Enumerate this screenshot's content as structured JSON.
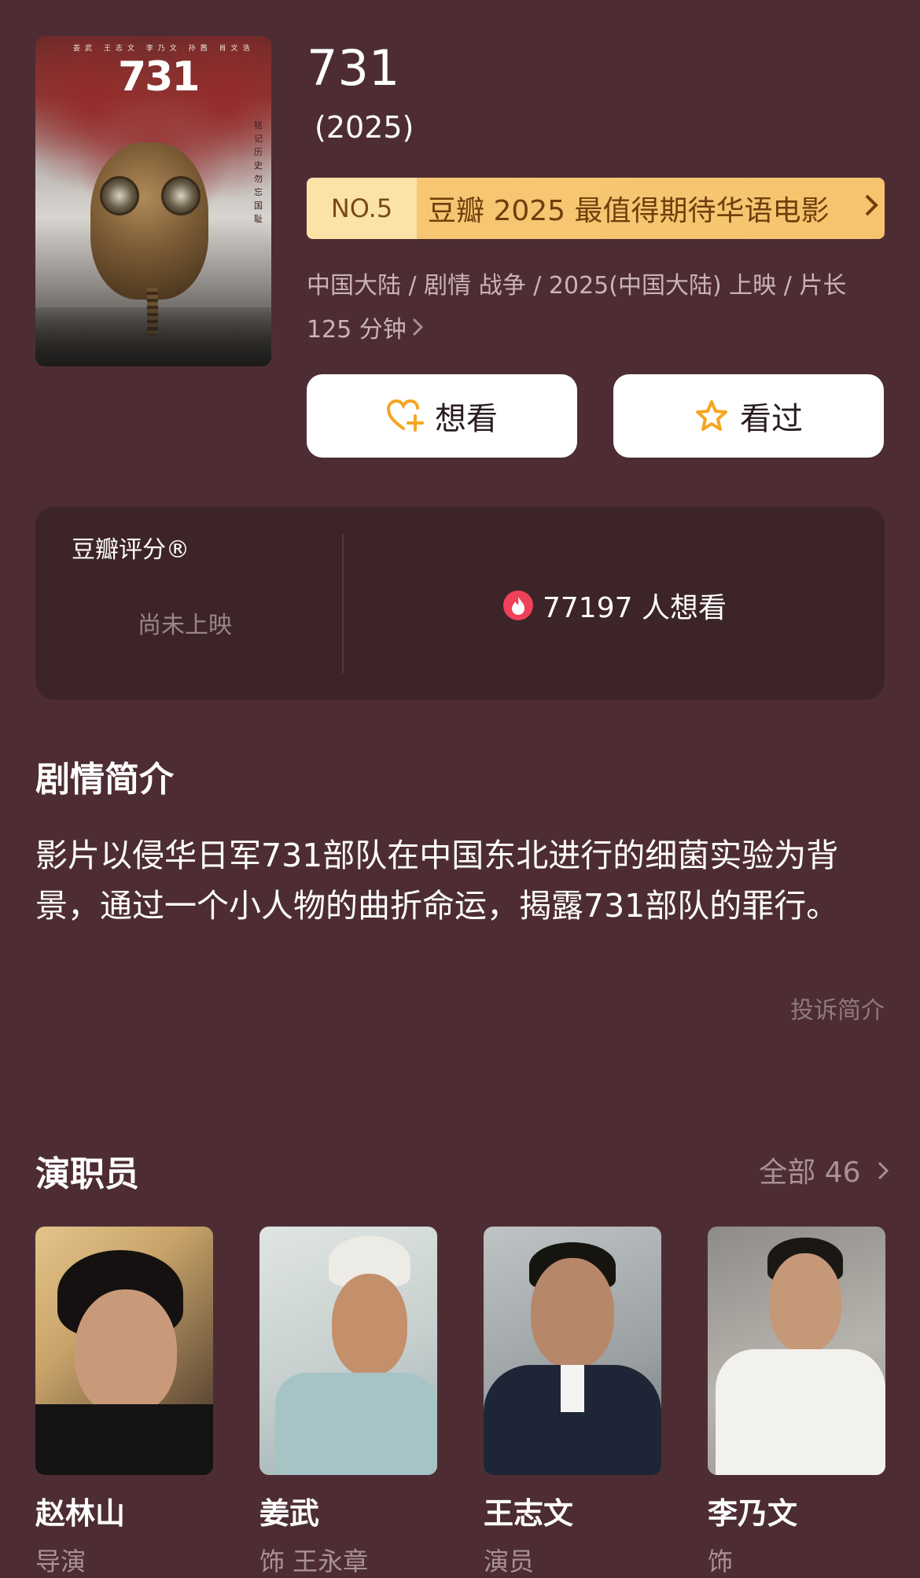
{
  "movie": {
    "title": "731",
    "year": "(2025)",
    "poster": {
      "title": "731",
      "credits": "姜武 王志文 李乃文 孙茜 肖文浩",
      "side_text": "铭记历史 勿忘国耻"
    },
    "rank": {
      "number": "NO.5",
      "text": "豆瓣 2025 最值得期待华语电影"
    },
    "meta_line": "中国大陆 / 剧情 战争 / 2025(中国大陆) 上映 / 片长 125 分钟",
    "actions": {
      "want": "想看",
      "watched": "看过"
    }
  },
  "rating": {
    "title": "豆瓣评分®",
    "status": "尚未上映",
    "wish_count": "77197 人想看"
  },
  "synopsis": {
    "title": "剧情简介",
    "text": "影片以侵华日军731部队在中国东北进行的细菌实验为背景，通过一个小人物的曲折命运，揭露731部队的罪行。",
    "report": "投诉简介"
  },
  "cast": {
    "title": "演职员",
    "see_all": "全部 46",
    "members": [
      {
        "name": "赵林山",
        "role": "导演"
      },
      {
        "name": "姜武",
        "role": "饰 王永章"
      },
      {
        "name": "王志文",
        "role": "演员"
      },
      {
        "name": "李乃文",
        "role": "饰"
      }
    ]
  },
  "colors": {
    "background": "#4d2d33",
    "card": "#3c2428",
    "rank_gold": "#f7c774",
    "accent_orange": "#f5a623",
    "fire_red": "#f0415a"
  },
  "icons": [
    "chevron-right-icon",
    "heart-plus-icon",
    "star-icon",
    "fire-icon"
  ]
}
